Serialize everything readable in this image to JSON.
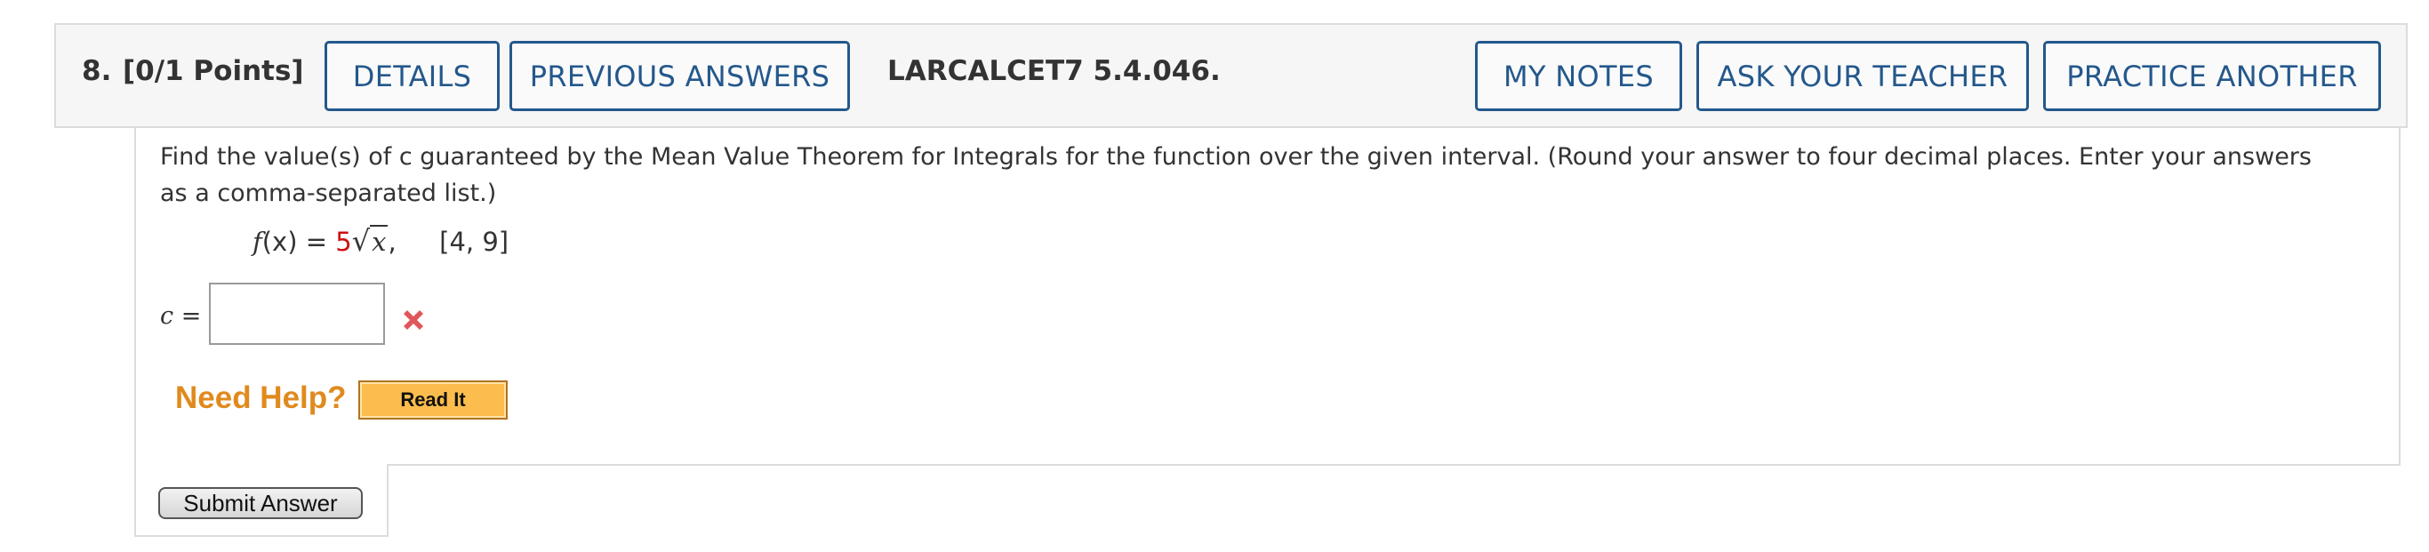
{
  "question": {
    "number": "8.",
    "points": "[0/1 Points]",
    "code": "LARCALCET7 5.4.046.",
    "text": "Find the value(s) of c guaranteed by the Mean Value Theorem for Integrals for the function over the given interval. (Round your answer to four decimal places. Enter your answers as a comma-separated list.)"
  },
  "header_buttons": {
    "details": "DETAILS",
    "previous_answers": "PREVIOUS ANSWERS",
    "my_notes": "MY NOTES",
    "ask_teacher": "ASK YOUR TEACHER",
    "practice_another": "PRACTICE ANOTHER"
  },
  "math": {
    "fn_name": "f",
    "fn_arg": "(x)",
    "equals": " = ",
    "coefficient": "5",
    "radicand": "x",
    "comma": ",",
    "interval": "[4, 9]"
  },
  "answer": {
    "var": "c",
    "equals": " =",
    "value": "",
    "status": "incorrect"
  },
  "help": {
    "label": "Need Help?",
    "read_it": "Read It"
  },
  "submit": {
    "label": "Submit Answer"
  },
  "colors": {
    "button_border": "#24588c",
    "coefficient_red": "#cc1111",
    "need_help_orange": "#e08a1e",
    "read_it_bg": "#fbbd4d",
    "wrong_icon": "#e0575b"
  }
}
